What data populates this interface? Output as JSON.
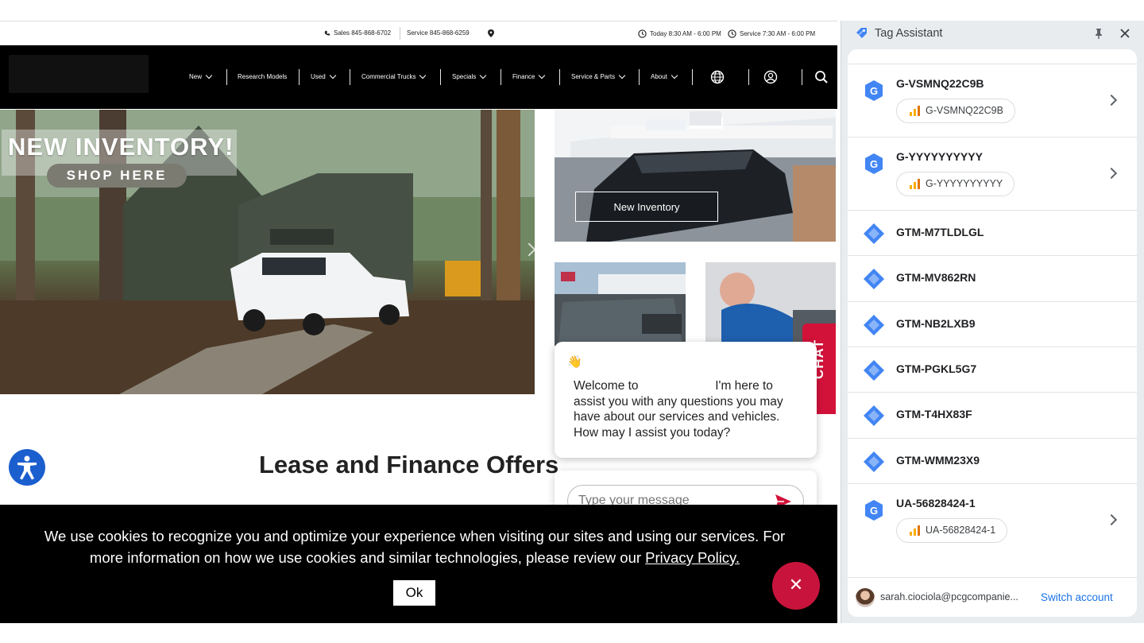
{
  "site": {
    "topbar": {
      "sales": "Sales 845-868-6702",
      "service": "Service 845-868-6259",
      "hours_today": "Today 8:30 AM - 6:00 PM",
      "hours_service": "Service 7:30 AM - 6:00 PM"
    },
    "nav": {
      "items": [
        "New",
        "Research Models",
        "Used",
        "Commercial Trucks",
        "Specials",
        "Finance",
        "Service & Parts",
        "About"
      ]
    },
    "hero": {
      "title": "NEW INVENTORY!",
      "button": "SHOP HERE"
    },
    "tiles": {
      "new_inventory_label": "New Inventory"
    },
    "chat_tab": "CHAT",
    "section_title": "Lease and Finance Offers",
    "chat": {
      "wave": "👋",
      "welcome_start": "Welcome to",
      "welcome_end": "I'm here to assist you with any questions you may have about our services and vehicles. How may I assist you today?",
      "input_placeholder": "Type your message"
    },
    "cookie": {
      "text": "We use cookies to recognize you and optimize your experience when visiting our sites and using our services. For more information on how we use cookies and similar technologies, please review our",
      "link": "Privacy Policy.",
      "ok": "Ok"
    },
    "close_fab": "✕"
  },
  "panel": {
    "title": "Tag Assistant",
    "tags": [
      {
        "name": "G-VSMNQ22C9B",
        "type": "ga",
        "pill": "G-VSMNQ22C9B"
      },
      {
        "name": "G-YYYYYYYYYY",
        "type": "ga",
        "pill": "G-YYYYYYYYYY"
      },
      {
        "name": "GTM-M7TLDLGL",
        "type": "gtm"
      },
      {
        "name": "GTM-MV862RN",
        "type": "gtm"
      },
      {
        "name": "GTM-NB2LXB9",
        "type": "gtm"
      },
      {
        "name": "GTM-PGKL5G7",
        "type": "gtm"
      },
      {
        "name": "GTM-T4HX83F",
        "type": "gtm"
      },
      {
        "name": "GTM-WMM23X9",
        "type": "gtm"
      },
      {
        "name": "UA-56828424-1",
        "type": "ga",
        "pill": "UA-56828424-1"
      }
    ],
    "footer": {
      "email": "sarah.ciociola@pcgcompanie...",
      "switch": "Switch account"
    }
  },
  "colors": {
    "brand_red": "#d3123a",
    "ga_blue": "#4285f4",
    "gtm_blue": "#4285f4",
    "link_blue": "#1a73e8",
    "accessibility_blue": "#1b5fce"
  }
}
